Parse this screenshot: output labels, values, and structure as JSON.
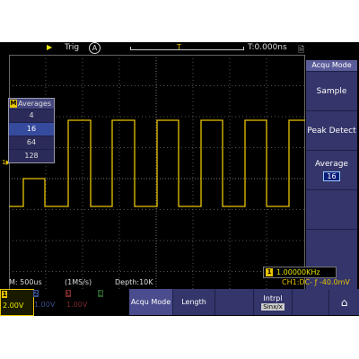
{
  "topbar": {
    "run_icon": "▶",
    "trig_label": "Trig",
    "trig_mode_icon": "A",
    "trig_marker": "T",
    "time_offset": "T:0.000ns",
    "disk_icon": "🗎"
  },
  "acqu_menu": {
    "title": "Acqu Mode",
    "items": [
      {
        "label": "Sample"
      },
      {
        "label": "Peak Detect"
      },
      {
        "label": "Average",
        "value": "16"
      },
      {
        "label": ""
      },
      {
        "label": ""
      }
    ]
  },
  "averages_popup": {
    "badge": "M",
    "title": "Averages",
    "options": [
      "4",
      "16",
      "64",
      "128"
    ],
    "selected": "16"
  },
  "ch1_marker": "1▶",
  "frequency": {
    "channel": "1",
    "value": "1.00000KHz"
  },
  "status": {
    "timebase": "M: 500us",
    "sample_rate": "(1MS/s)",
    "depth": "Depth:10K",
    "trigger": "CH1:DC- ƒ -40.0mV"
  },
  "channels": [
    {
      "num": "1",
      "volts": "2.00V"
    },
    {
      "num": "2",
      "volts": "1.00V"
    },
    {
      "num": "3",
      "volts": "1.00V"
    },
    {
      "num": "4",
      "volts": ""
    }
  ],
  "buttons": {
    "acqu_mode": "Acqu Mode",
    "length": "Length",
    "intrpl": "Intrpl",
    "intrpl_value": "Sinx/x",
    "home_icon": "⌂"
  },
  "colors": {
    "ch1": "#e8c400",
    "menu_bg": "#34356a",
    "screen_bg": "#000000"
  }
}
